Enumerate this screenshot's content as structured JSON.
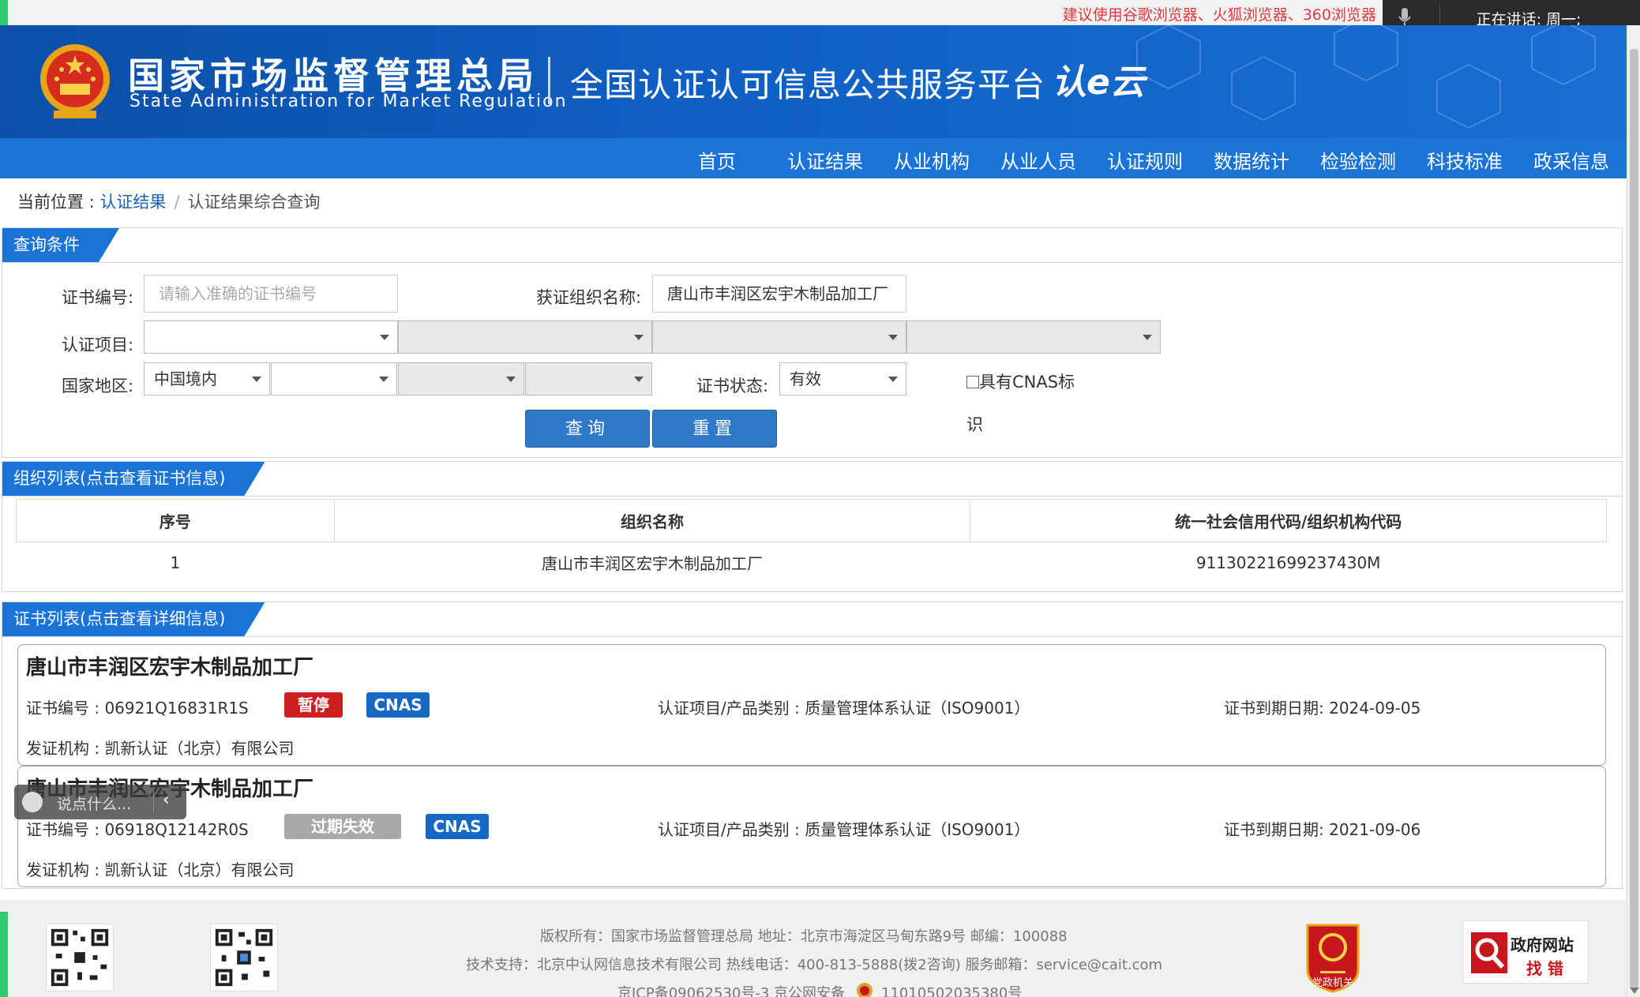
{
  "topbar": {
    "browser_tip": "建议使用谷歌浏览器、火狐浏览器、360浏览器",
    "speaking_label": "正在讲话:  周一;"
  },
  "header": {
    "org_cn": "国家市场监督管理总局",
    "org_en": "State Administration  for  Market Regulation",
    "platform_title": "全国认证认可信息公共服务平台",
    "cloud_logo": "认e云"
  },
  "nav": {
    "items": [
      "首页",
      "认证结果",
      "从业机构",
      "从业人员",
      "认证规则",
      "数据统计",
      "检验检测",
      "科技标准",
      "政采信息"
    ]
  },
  "breadcrumb": {
    "prefix": "当前位置 : ",
    "link": "认证结果",
    "separator": "/",
    "current": "认证结果综合查询"
  },
  "query": {
    "tab": "查询条件",
    "cert_no_label": "证书编号:",
    "cert_no_placeholder": "请输入准确的证书编号",
    "org_name_label": "获证组织名称:",
    "org_name_value": "唐山市丰润区宏宇木制品加工厂",
    "project_label": "认证项目:",
    "region_label": "国家地区:",
    "region_value": "中国境内",
    "status_label": "证书状态:",
    "status_value": "有效",
    "cnas_checkbox": "具有CNAS标识",
    "search_button": "查询",
    "reset_button": "重置"
  },
  "org_list": {
    "tab": "组织列表(点击查看证书信息)",
    "headers": [
      "序号",
      "组织名称",
      "统一社会信用代码/组织机构代码"
    ],
    "rows": [
      {
        "no": "1",
        "name": "唐山市丰润区宏宇木制品加工厂",
        "code": "91130221699237430M"
      }
    ]
  },
  "cert_list": {
    "tab": "证书列表(点击查看详细信息)",
    "cards": [
      {
        "org": "唐山市丰润区宏宇木制品加工厂",
        "cert_no": "证书编号 : 06921Q16831R1S",
        "status": "暂停",
        "cnas": "CNAS",
        "project": "认证项目/产品类别 : 质量管理体系认证（ISO9001）",
        "expiry": "证书到期日期: 2024-09-05",
        "issuer": "发证机构 : 凯新认证（北京）有限公司"
      },
      {
        "org": "唐山市丰润区宏宇木制品加工厂",
        "cert_no": "证书编号 : 06918Q12142R0S",
        "status": "过期失效",
        "cnas": "CNAS",
        "project": "认证项目/产品类别 : 质量管理体系认证（ISO9001）",
        "expiry": "证书到期日期: 2021-09-06",
        "issuer": "发证机构 : 凯新认证（北京）有限公司"
      }
    ]
  },
  "chat": {
    "placeholder": "说点什么..."
  },
  "footer": {
    "line1": "版权所有：国家市场监督管理总局    地址：北京市海淀区马甸东路9号    邮编：100088",
    "line2": "技术支持：北京中认网信息技术有限公司    热线电话：400-813-5888(拨2咨询)    服务邮箱：service@cait.com",
    "line3": "京ICP备09062530号-3      京公网安备",
    "police_no": "11010502035380号",
    "party_badge": "党政机关",
    "gov_find_1": "政府网站",
    "gov_find_2": "找 错"
  },
  "colors": {
    "header_blue": "#0b4fa8",
    "nav_blue": "#1a74d8",
    "status_suspended": "#cc1f1f",
    "status_expired": "#a8a8a8",
    "cnas_blue": "#1668c5"
  }
}
